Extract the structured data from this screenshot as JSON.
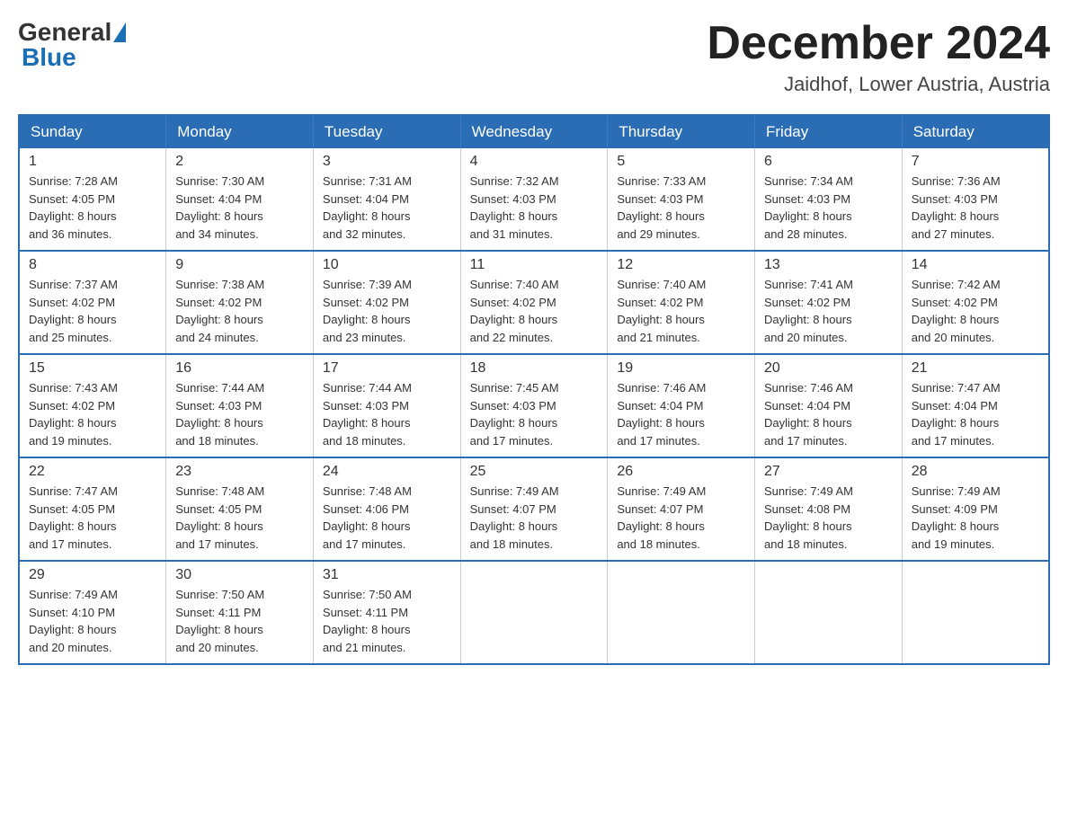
{
  "header": {
    "logo": {
      "general": "General",
      "blue": "Blue"
    },
    "title": "December 2024",
    "location": "Jaidhof, Lower Austria, Austria"
  },
  "days_of_week": [
    "Sunday",
    "Monday",
    "Tuesday",
    "Wednesday",
    "Thursday",
    "Friday",
    "Saturday"
  ],
  "weeks": [
    [
      {
        "day": "1",
        "sunrise": "7:28 AM",
        "sunset": "4:05 PM",
        "daylight": "8 hours and 36 minutes."
      },
      {
        "day": "2",
        "sunrise": "7:30 AM",
        "sunset": "4:04 PM",
        "daylight": "8 hours and 34 minutes."
      },
      {
        "day": "3",
        "sunrise": "7:31 AM",
        "sunset": "4:04 PM",
        "daylight": "8 hours and 32 minutes."
      },
      {
        "day": "4",
        "sunrise": "7:32 AM",
        "sunset": "4:03 PM",
        "daylight": "8 hours and 31 minutes."
      },
      {
        "day": "5",
        "sunrise": "7:33 AM",
        "sunset": "4:03 PM",
        "daylight": "8 hours and 29 minutes."
      },
      {
        "day": "6",
        "sunrise": "7:34 AM",
        "sunset": "4:03 PM",
        "daylight": "8 hours and 28 minutes."
      },
      {
        "day": "7",
        "sunrise": "7:36 AM",
        "sunset": "4:03 PM",
        "daylight": "8 hours and 27 minutes."
      }
    ],
    [
      {
        "day": "8",
        "sunrise": "7:37 AM",
        "sunset": "4:02 PM",
        "daylight": "8 hours and 25 minutes."
      },
      {
        "day": "9",
        "sunrise": "7:38 AM",
        "sunset": "4:02 PM",
        "daylight": "8 hours and 24 minutes."
      },
      {
        "day": "10",
        "sunrise": "7:39 AM",
        "sunset": "4:02 PM",
        "daylight": "8 hours and 23 minutes."
      },
      {
        "day": "11",
        "sunrise": "7:40 AM",
        "sunset": "4:02 PM",
        "daylight": "8 hours and 22 minutes."
      },
      {
        "day": "12",
        "sunrise": "7:40 AM",
        "sunset": "4:02 PM",
        "daylight": "8 hours and 21 minutes."
      },
      {
        "day": "13",
        "sunrise": "7:41 AM",
        "sunset": "4:02 PM",
        "daylight": "8 hours and 20 minutes."
      },
      {
        "day": "14",
        "sunrise": "7:42 AM",
        "sunset": "4:02 PM",
        "daylight": "8 hours and 20 minutes."
      }
    ],
    [
      {
        "day": "15",
        "sunrise": "7:43 AM",
        "sunset": "4:02 PM",
        "daylight": "8 hours and 19 minutes."
      },
      {
        "day": "16",
        "sunrise": "7:44 AM",
        "sunset": "4:03 PM",
        "daylight": "8 hours and 18 minutes."
      },
      {
        "day": "17",
        "sunrise": "7:44 AM",
        "sunset": "4:03 PM",
        "daylight": "8 hours and 18 minutes."
      },
      {
        "day": "18",
        "sunrise": "7:45 AM",
        "sunset": "4:03 PM",
        "daylight": "8 hours and 17 minutes."
      },
      {
        "day": "19",
        "sunrise": "7:46 AM",
        "sunset": "4:04 PM",
        "daylight": "8 hours and 17 minutes."
      },
      {
        "day": "20",
        "sunrise": "7:46 AM",
        "sunset": "4:04 PM",
        "daylight": "8 hours and 17 minutes."
      },
      {
        "day": "21",
        "sunrise": "7:47 AM",
        "sunset": "4:04 PM",
        "daylight": "8 hours and 17 minutes."
      }
    ],
    [
      {
        "day": "22",
        "sunrise": "7:47 AM",
        "sunset": "4:05 PM",
        "daylight": "8 hours and 17 minutes."
      },
      {
        "day": "23",
        "sunrise": "7:48 AM",
        "sunset": "4:05 PM",
        "daylight": "8 hours and 17 minutes."
      },
      {
        "day": "24",
        "sunrise": "7:48 AM",
        "sunset": "4:06 PM",
        "daylight": "8 hours and 17 minutes."
      },
      {
        "day": "25",
        "sunrise": "7:49 AM",
        "sunset": "4:07 PM",
        "daylight": "8 hours and 18 minutes."
      },
      {
        "day": "26",
        "sunrise": "7:49 AM",
        "sunset": "4:07 PM",
        "daylight": "8 hours and 18 minutes."
      },
      {
        "day": "27",
        "sunrise": "7:49 AM",
        "sunset": "4:08 PM",
        "daylight": "8 hours and 18 minutes."
      },
      {
        "day": "28",
        "sunrise": "7:49 AM",
        "sunset": "4:09 PM",
        "daylight": "8 hours and 19 minutes."
      }
    ],
    [
      {
        "day": "29",
        "sunrise": "7:49 AM",
        "sunset": "4:10 PM",
        "daylight": "8 hours and 20 minutes."
      },
      {
        "day": "30",
        "sunrise": "7:50 AM",
        "sunset": "4:11 PM",
        "daylight": "8 hours and 20 minutes."
      },
      {
        "day": "31",
        "sunrise": "7:50 AM",
        "sunset": "4:11 PM",
        "daylight": "8 hours and 21 minutes."
      },
      null,
      null,
      null,
      null
    ]
  ],
  "labels": {
    "sunrise": "Sunrise:",
    "sunset": "Sunset:",
    "daylight": "Daylight:"
  }
}
